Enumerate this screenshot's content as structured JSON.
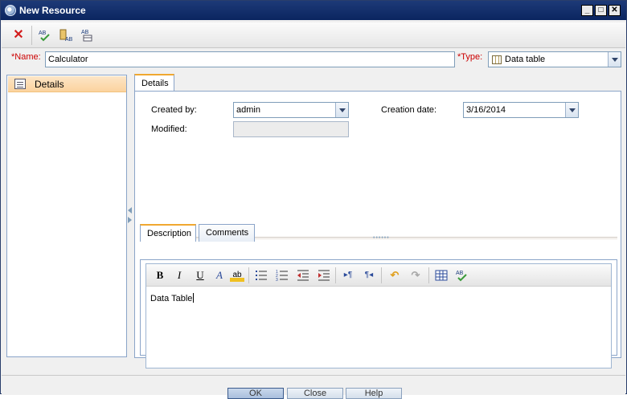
{
  "window": {
    "title": "New Resource",
    "controls": {
      "minimize": "_",
      "maximize": "□",
      "close": "✕"
    }
  },
  "toolbar": {
    "icons": [
      "delete-icon",
      "spell-check-icon",
      "find-replace-icon",
      "field-check-icon"
    ]
  },
  "header": {
    "name_label": "Name:",
    "name_value": "Calculator",
    "type_label": "Type:",
    "type_value": "Data table",
    "required_mark": "*"
  },
  "sidebar": {
    "items": [
      {
        "label": "Details",
        "selected": true
      }
    ]
  },
  "tabs": [
    {
      "label": "Details",
      "active": true
    }
  ],
  "details": {
    "created_by_label": "Created by:",
    "created_by_value": "admin",
    "creation_date_label": "Creation date:",
    "creation_date_value": "3/16/2014",
    "modified_label": "Modified:",
    "modified_value": ""
  },
  "inner_tabs": [
    {
      "label": "Description",
      "active": true
    },
    {
      "label": "Comments",
      "active": false
    }
  ],
  "editor": {
    "text": "Data Table",
    "toolbar": {
      "bold": "B",
      "italic": "I",
      "underline": "U",
      "font_color": "A",
      "highlight": "ab"
    }
  },
  "buttons": {
    "ok": "OK",
    "close": "Close",
    "help": "Help"
  },
  "colors": {
    "titlebar": "#0b2560",
    "selected_item": "#fbd39e",
    "required": "#cc0000",
    "border": "#8aa4c8"
  }
}
